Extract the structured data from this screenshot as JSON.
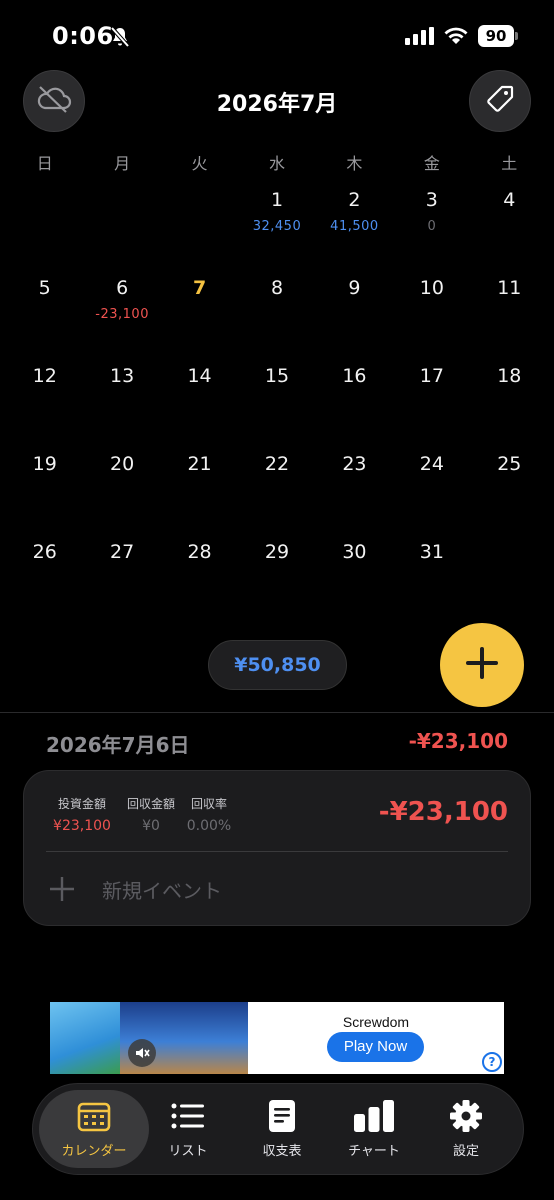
{
  "status_bar": {
    "time": "0:06",
    "battery": "90"
  },
  "header": {
    "title": "2026年7月"
  },
  "weekdays": [
    "日",
    "月",
    "火",
    "水",
    "木",
    "金",
    "土"
  ],
  "calendar": [
    {
      "day": "",
      "amount": "",
      "kind": ""
    },
    {
      "day": "",
      "amount": "",
      "kind": ""
    },
    {
      "day": "",
      "amount": "",
      "kind": ""
    },
    {
      "day": "1",
      "amount": "32,450",
      "kind": "pos"
    },
    {
      "day": "2",
      "amount": "41,500",
      "kind": "pos"
    },
    {
      "day": "3",
      "amount": "0",
      "kind": "zero"
    },
    {
      "day": "4",
      "amount": "",
      "kind": ""
    },
    {
      "day": "5",
      "amount": "",
      "kind": ""
    },
    {
      "day": "6",
      "amount": "-23,100",
      "kind": "neg",
      "selected": true
    },
    {
      "day": "7",
      "amount": "",
      "kind": "",
      "today": true
    },
    {
      "day": "8",
      "amount": "",
      "kind": ""
    },
    {
      "day": "9",
      "amount": "",
      "kind": ""
    },
    {
      "day": "10",
      "amount": "",
      "kind": ""
    },
    {
      "day": "11",
      "amount": "",
      "kind": ""
    },
    {
      "day": "12",
      "amount": "",
      "kind": ""
    },
    {
      "day": "13",
      "amount": "",
      "kind": ""
    },
    {
      "day": "14",
      "amount": "",
      "kind": ""
    },
    {
      "day": "15",
      "amount": "",
      "kind": ""
    },
    {
      "day": "16",
      "amount": "",
      "kind": ""
    },
    {
      "day": "17",
      "amount": "",
      "kind": ""
    },
    {
      "day": "18",
      "amount": "",
      "kind": ""
    },
    {
      "day": "19",
      "amount": "",
      "kind": ""
    },
    {
      "day": "20",
      "amount": "",
      "kind": ""
    },
    {
      "day": "21",
      "amount": "",
      "kind": ""
    },
    {
      "day": "22",
      "amount": "",
      "kind": ""
    },
    {
      "day": "23",
      "amount": "",
      "kind": ""
    },
    {
      "day": "24",
      "amount": "",
      "kind": ""
    },
    {
      "day": "25",
      "amount": "",
      "kind": ""
    },
    {
      "day": "26",
      "amount": "",
      "kind": ""
    },
    {
      "day": "27",
      "amount": "",
      "kind": ""
    },
    {
      "day": "28",
      "amount": "",
      "kind": ""
    },
    {
      "day": "29",
      "amount": "",
      "kind": ""
    },
    {
      "day": "30",
      "amount": "",
      "kind": ""
    },
    {
      "day": "31",
      "amount": "",
      "kind": ""
    }
  ],
  "summary": {
    "month_total": "¥50,850"
  },
  "detail": {
    "date": "2026年7月6日",
    "total": "-¥23,100",
    "invest_label": "投資金額",
    "invest_value": "¥23,100",
    "return_label": "回収金額",
    "return_value": "¥0",
    "rate_label": "回収率",
    "rate_value": "0.00%",
    "card_amount": "-¥23,100",
    "new_event": "新規イベント"
  },
  "ad": {
    "title": "Screwdom",
    "cta": "Play Now",
    "help": "?"
  },
  "tabs": [
    {
      "label": "カレンダー",
      "icon": "calendar-icon"
    },
    {
      "label": "リスト",
      "icon": "list-icon"
    },
    {
      "label": "収支表",
      "icon": "document-icon"
    },
    {
      "label": "チャート",
      "icon": "bar-chart-icon"
    },
    {
      "label": "設定",
      "icon": "gear-icon"
    }
  ],
  "colors": {
    "accent": "#f5c542",
    "positive": "#4e8ff0",
    "negative": "#ef5350"
  }
}
